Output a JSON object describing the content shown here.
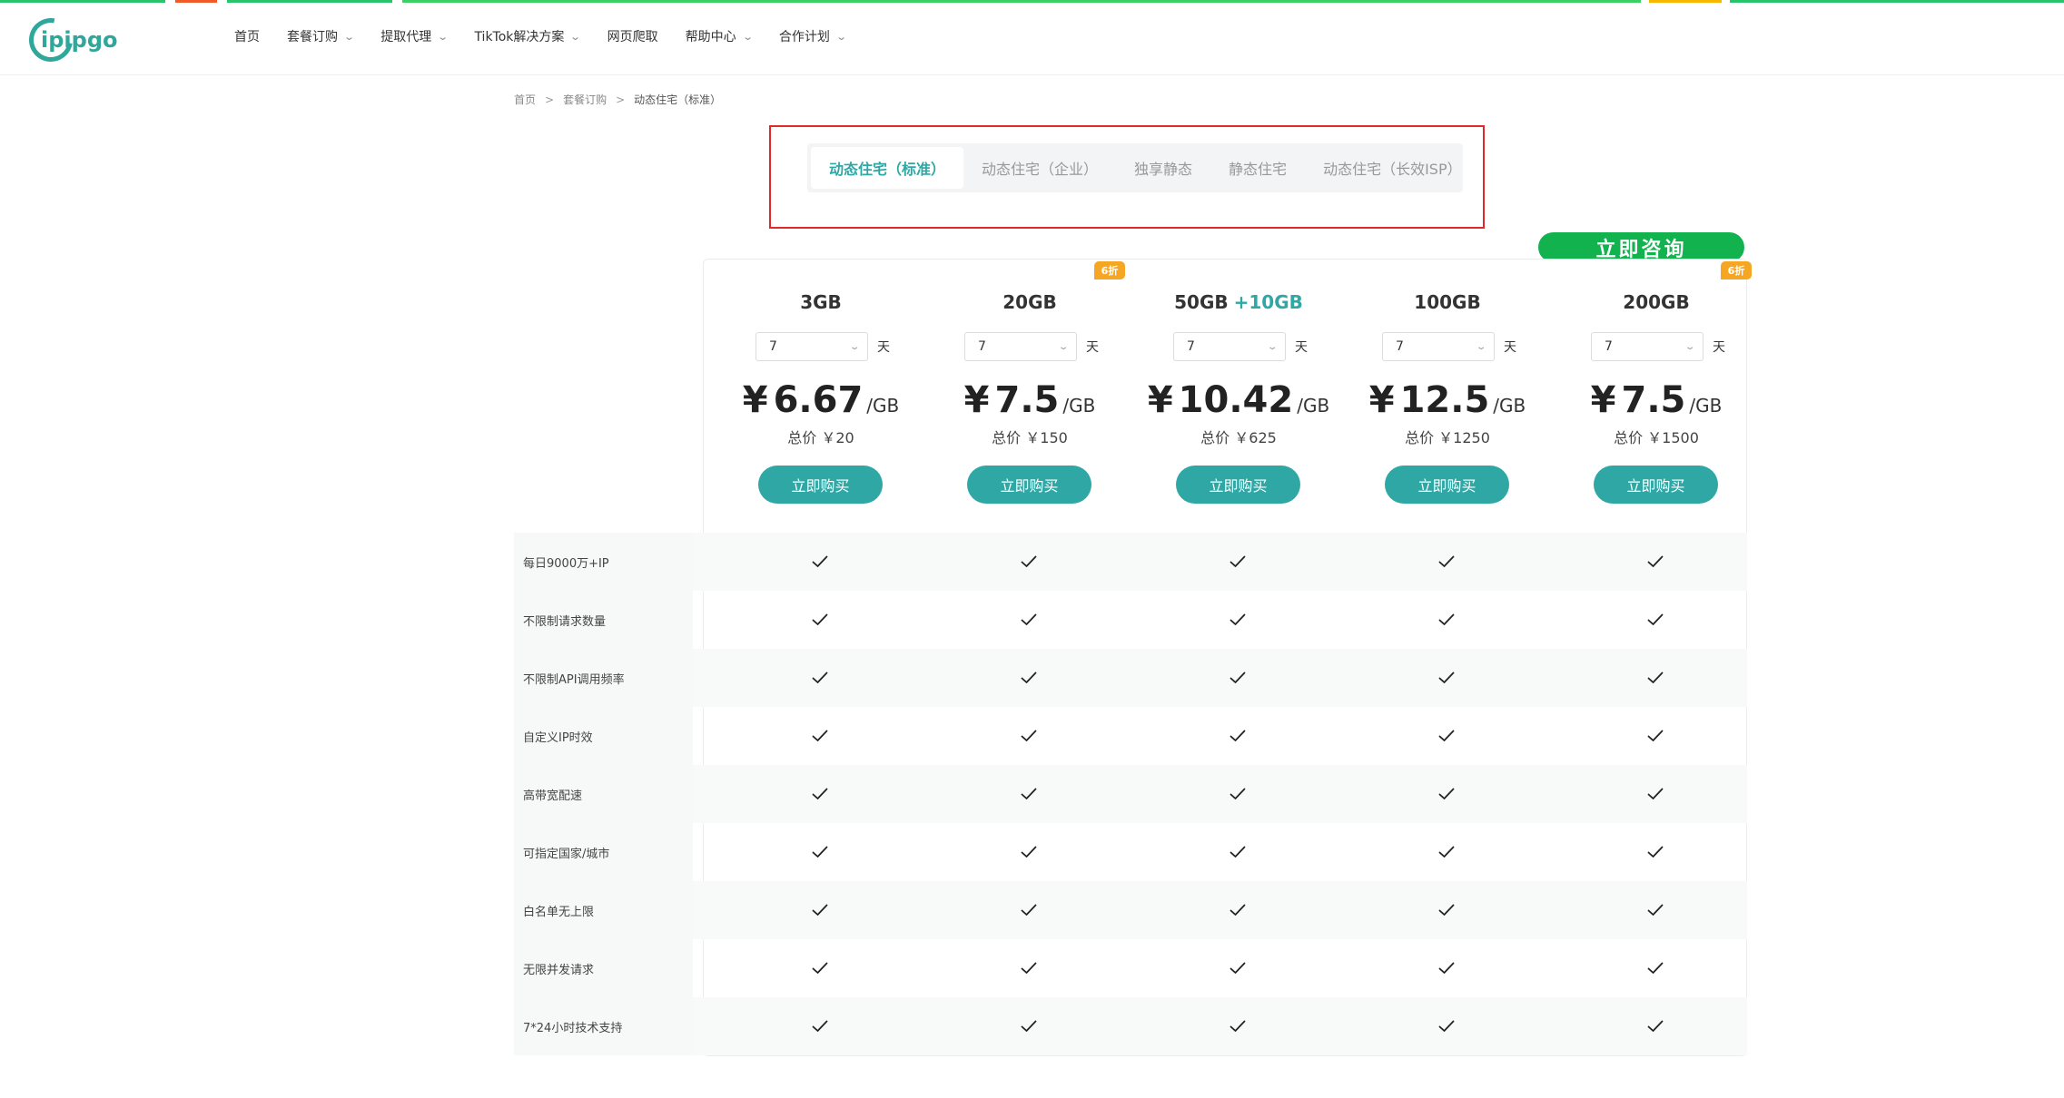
{
  "top_strip": [
    {
      "color": "#27c46b",
      "fraction": 0.08
    },
    {
      "color": "#ffffff",
      "fraction": 0.005
    },
    {
      "color": "#f05a28",
      "fraction": 0.02
    },
    {
      "color": "#ffffff",
      "fraction": 0.005
    },
    {
      "color": "#27c46b",
      "fraction": 0.08
    },
    {
      "color": "#ffffff",
      "fraction": 0.005
    },
    {
      "color": "#3ccf63",
      "fraction": 0.6
    },
    {
      "color": "#ffffff",
      "fraction": 0.004
    },
    {
      "color": "#f5b700",
      "fraction": 0.035
    },
    {
      "color": "#ffffff",
      "fraction": 0.004
    },
    {
      "color": "#27c46b",
      "fraction": 0.162
    }
  ],
  "header": {
    "logo_text": "ipipgo",
    "nav": [
      {
        "label": "首页",
        "has_dropdown": false
      },
      {
        "label": "套餐订购",
        "has_dropdown": true
      },
      {
        "label": "提取代理",
        "has_dropdown": true
      },
      {
        "label": "TikTok解决方案",
        "has_dropdown": true
      },
      {
        "label": "网页爬取",
        "has_dropdown": false
      },
      {
        "label": "帮助中心",
        "has_dropdown": true
      },
      {
        "label": "合作计划",
        "has_dropdown": true
      }
    ]
  },
  "breadcrumb": {
    "items": [
      "首页",
      "套餐订购"
    ],
    "current": "动态住宅（标准）",
    "separator": ">"
  },
  "tabs": [
    {
      "label": "动态住宅（标准）",
      "active": true
    },
    {
      "label": "动态住宅（企业）",
      "active": false
    },
    {
      "label": "独享静态",
      "active": false
    },
    {
      "label": "静态住宅",
      "active": false
    },
    {
      "label": "动态住宅（长效ISP）",
      "active": false
    }
  ],
  "consult_button": "立即咨询",
  "plans": [
    {
      "title": "3GB",
      "bonus": "",
      "badge": "",
      "days": "7",
      "day_unit": "天",
      "currency": "¥",
      "price": "6.67",
      "per_unit": "/GB",
      "total": "总价 ￥20",
      "buy_label": "立即购买"
    },
    {
      "title": "20GB",
      "bonus": "",
      "badge": "6折",
      "days": "7",
      "day_unit": "天",
      "currency": "¥",
      "price": "7.5",
      "per_unit": "/GB",
      "total": "总价 ￥150",
      "buy_label": "立即购买"
    },
    {
      "title": "50GB",
      "bonus": "+10GB",
      "badge": "",
      "days": "7",
      "day_unit": "天",
      "currency": "¥",
      "price": "10.42",
      "per_unit": "/GB",
      "total": "总价 ￥625",
      "buy_label": "立即购买"
    },
    {
      "title": "100GB",
      "bonus": "",
      "badge": "",
      "days": "7",
      "day_unit": "天",
      "currency": "¥",
      "price": "12.5",
      "per_unit": "/GB",
      "total": "总价 ￥1250",
      "buy_label": "立即购买"
    },
    {
      "title": "200GB",
      "bonus": "",
      "badge": "6折",
      "days": "7",
      "day_unit": "天",
      "currency": "¥",
      "price": "7.5",
      "per_unit": "/GB",
      "total": "总价 ￥1500",
      "buy_label": "立即购买"
    }
  ],
  "features": [
    {
      "label": "每日9000万+IP",
      "included": [
        true,
        true,
        true,
        true,
        true
      ]
    },
    {
      "label": "不限制请求数量",
      "included": [
        true,
        true,
        true,
        true,
        true
      ]
    },
    {
      "label": "不限制API调用频率",
      "included": [
        true,
        true,
        true,
        true,
        true
      ]
    },
    {
      "label": "自定义IP时效",
      "included": [
        true,
        true,
        true,
        true,
        true
      ]
    },
    {
      "label": "高带宽配速",
      "included": [
        true,
        true,
        true,
        true,
        true
      ]
    },
    {
      "label": "可指定国家/城市",
      "included": [
        true,
        true,
        true,
        true,
        true
      ]
    },
    {
      "label": "白名单无上限",
      "included": [
        true,
        true,
        true,
        true,
        true
      ]
    },
    {
      "label": "无限并发请求",
      "included": [
        true,
        true,
        true,
        true,
        true
      ]
    },
    {
      "label": "7*24小时技术支持",
      "included": [
        true,
        true,
        true,
        true,
        true
      ]
    }
  ],
  "check_icon": "checkmark-icon",
  "colors": {
    "accent": "#2fa7a5",
    "consult": "#12b24f",
    "badge": "#f5a623",
    "frame": "#e02a2a"
  }
}
